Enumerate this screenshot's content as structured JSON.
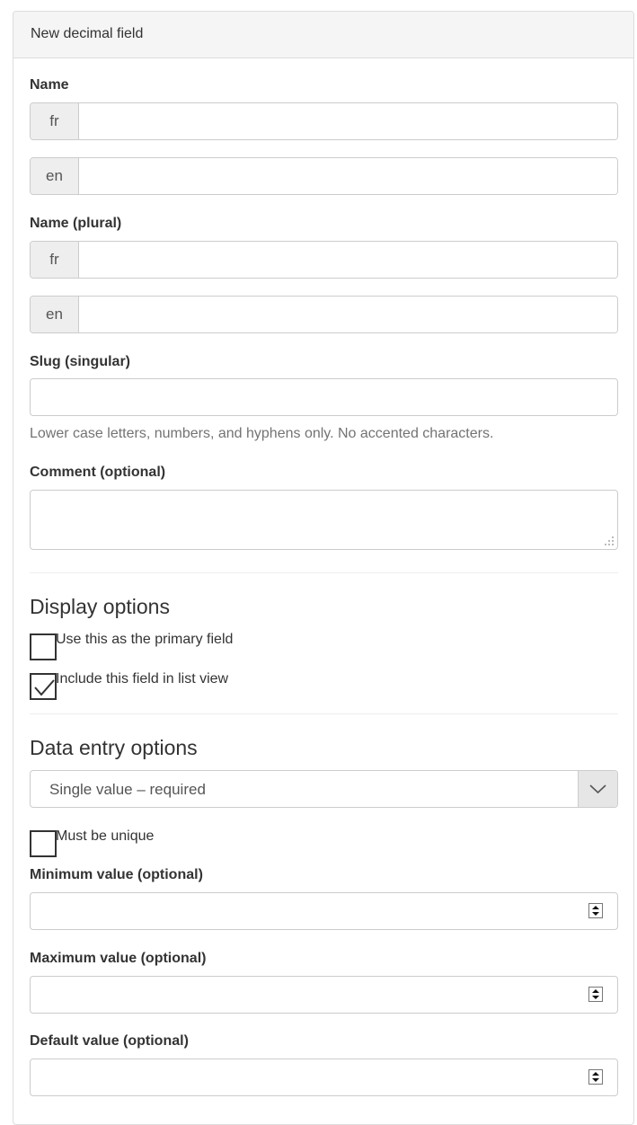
{
  "panel": {
    "title": "New decimal field"
  },
  "name": {
    "label": "Name",
    "fields": [
      {
        "lang": "fr",
        "value": ""
      },
      {
        "lang": "en",
        "value": ""
      }
    ]
  },
  "name_plural": {
    "label": "Name (plural)",
    "fields": [
      {
        "lang": "fr",
        "value": ""
      },
      {
        "lang": "en",
        "value": ""
      }
    ]
  },
  "slug": {
    "label": "Slug (singular)",
    "value": "",
    "help": "Lower case letters, numbers, and hyphens only. No accented characters."
  },
  "comment": {
    "label": "Comment (optional)",
    "value": ""
  },
  "display_options": {
    "heading": "Display options",
    "primary_field": {
      "label": "Use this as the primary field",
      "checked": false
    },
    "list_view": {
      "label": "Include this field in list view",
      "checked": true
    }
  },
  "data_entry": {
    "heading": "Data entry options",
    "select_value": "Single value – required",
    "unique": {
      "label": "Must be unique",
      "checked": false
    }
  },
  "minimum": {
    "label": "Minimum value (optional)",
    "value": ""
  },
  "maximum": {
    "label": "Maximum value (optional)",
    "value": ""
  },
  "default": {
    "label": "Default value (optional)",
    "value": ""
  },
  "icons": {
    "checkmark": "checkmark-icon",
    "chevron": "chevron-down-icon",
    "spinner": "spinner-arrows-icon",
    "resize": "resize-grip-icon"
  },
  "colors": {
    "border": "#cccccc",
    "addon_bg": "#eeeeee",
    "heading_bg": "#f5f5f5",
    "help_text": "#737373"
  }
}
